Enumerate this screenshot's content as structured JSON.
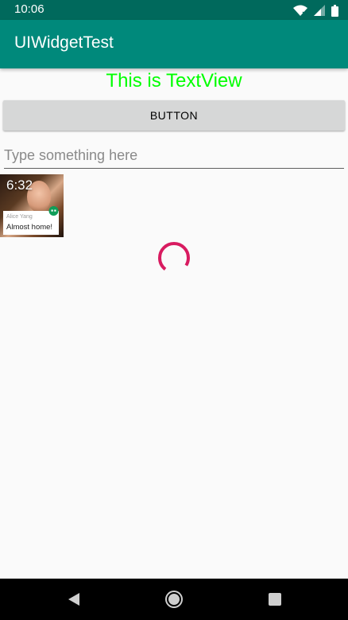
{
  "status_bar": {
    "time": "10:06"
  },
  "app_bar": {
    "title": "UIWidgetTest"
  },
  "main": {
    "text_view": "This is TextView",
    "button_label": "BUTTON",
    "edit_text": {
      "placeholder": "Type something here",
      "value": ""
    },
    "image_view": {
      "time": "6:32",
      "notification_sender": "Alice Yang",
      "notification_message": "Almost home!"
    },
    "progress_color": "#d81b60"
  },
  "colors": {
    "status_bar": "#00695c",
    "app_bar": "#00897b",
    "text_view": "#00ff00",
    "button": "#d6d7d7",
    "background": "#fafafa"
  },
  "icons": {
    "status": [
      "wifi-icon",
      "signal-icon",
      "battery-icon"
    ],
    "nav": [
      "back-icon",
      "home-icon",
      "recents-icon"
    ]
  }
}
